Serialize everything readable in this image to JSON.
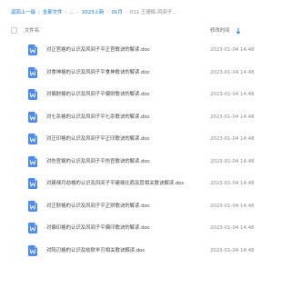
{
  "breadcrumb": {
    "items": [
      "返回上一级",
      "全部文件",
      "...",
      "2023上新",
      "01月",
      "011.王德辉-风间子..."
    ],
    "separator": "|",
    "chevron": "›"
  },
  "table": {
    "col_name": "文件名",
    "col_time": "修改时间",
    "sort_icon": "sort-down-arrow-icon",
    "file_icon": "word-doc-icon",
    "rows": [
      {
        "name": "对正官格的认识及风间子平正官歌诀的解读.doc",
        "time": "2023-01-04 14:48"
      },
      {
        "name": "对食神格的认识及风间子平食神歌诀的解读.doc",
        "time": "2023-01-04 14:48"
      },
      {
        "name": "对偏财格的认识及风间子平偏财歌诀的解读.doc",
        "time": "2023-01-04 14:48"
      },
      {
        "name": "对七杀格的认识及风间子平七杀歌诀的解读.doc",
        "time": "2023-01-04 14:48"
      },
      {
        "name": "对正印格的认识及风间子平正印歌诀的解读.doc",
        "time": "2023-01-04 14:48"
      },
      {
        "name": "对伤官格的认识及风间子平伤官歌诀的解读.doc",
        "time": "2023-01-04 14:48"
      },
      {
        "name": "对建禄月劫格的认识及风间子平建禄比肩及其相关歌诀解读.doc",
        "time": "2023-01-04 14:48"
      },
      {
        "name": "对正财格的认识及风间子平正财歌诀的解读.doc",
        "time": "2023-01-04 14:48"
      },
      {
        "name": "对偏印格的认识及风间子平偏印歌诀的解读.doc",
        "time": "2023-01-04 14:48"
      },
      {
        "name": "对阳刃格的认识及劫财羊刃相关歌诀解读.doc",
        "time": "2023-01-04 14:48"
      }
    ]
  },
  "colors": {
    "accent": "#0d73e6",
    "doc_icon": "#4b8bf5",
    "text": "#444444",
    "muted": "#888888"
  }
}
